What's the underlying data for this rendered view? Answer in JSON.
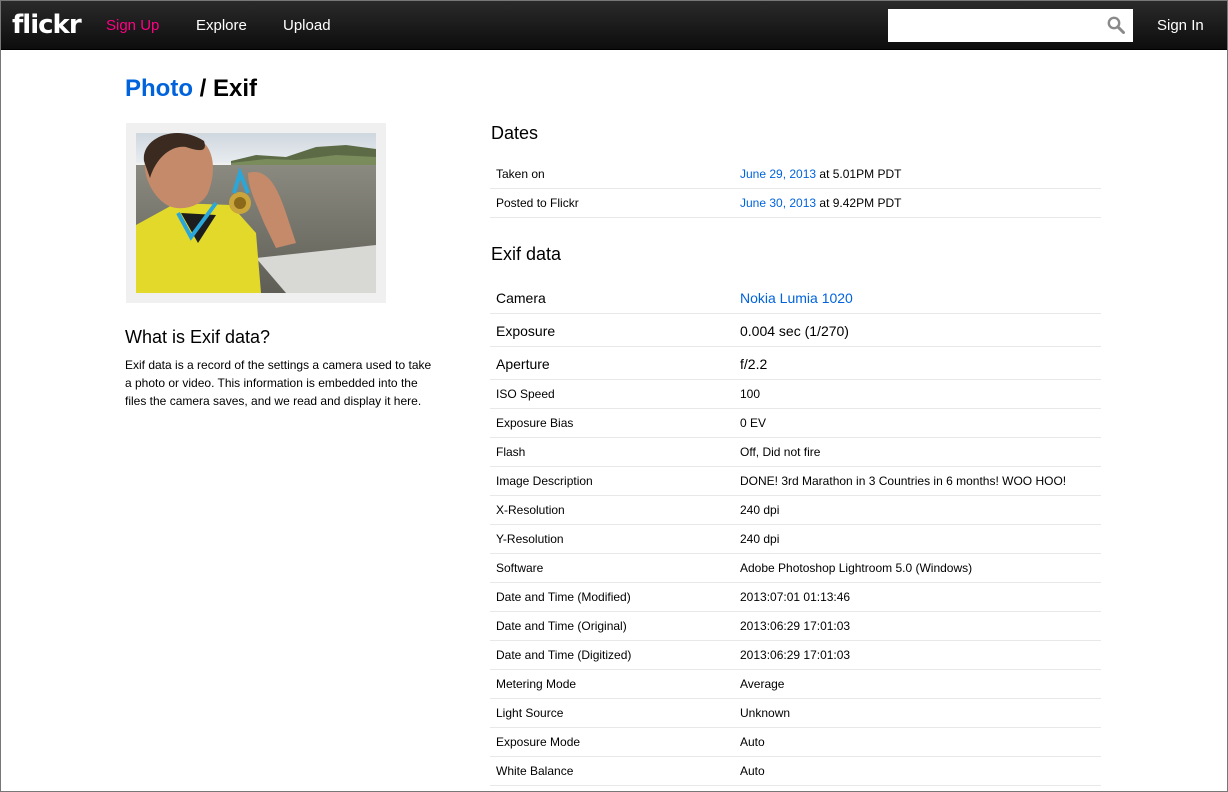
{
  "nav": {
    "logo": "flickr",
    "signup": "Sign Up",
    "explore": "Explore",
    "upload": "Upload",
    "search_placeholder": "",
    "signin": "Sign In",
    "colors": {
      "bar": "#111111",
      "signup": "#ff0084",
      "link": "#0063dc"
    }
  },
  "breadcrumb": {
    "photo": "Photo",
    "separator": " / ",
    "current": "Exif"
  },
  "sidebar": {
    "heading": "What is Exif data?",
    "text": "Exif data is a record of the settings a camera used to take a photo or video. This information is embedded into the files the camera saves, and we read and display it here."
  },
  "dates": {
    "heading": "Dates",
    "rows": [
      {
        "label": "Taken on",
        "date": "June 29, 2013",
        "time": " at 5.01PM PDT"
      },
      {
        "label": "Posted to Flickr",
        "date": "June 30, 2013",
        "time": " at 9.42PM PDT"
      }
    ]
  },
  "exif": {
    "heading": "Exif data",
    "camera": {
      "label": "Camera",
      "value": "Nokia Lumia 1020"
    },
    "exposure": {
      "label": "Exposure",
      "value": "0.004 sec (1/270)"
    },
    "aperture": {
      "label": "Aperture",
      "value": "f/2.2"
    },
    "rows": [
      {
        "label": "ISO Speed",
        "value": "100"
      },
      {
        "label": "Exposure Bias",
        "value": "0 EV"
      },
      {
        "label": "Flash",
        "value": "Off, Did not fire"
      },
      {
        "label": "Image Description",
        "value": "DONE! 3rd Marathon in 3 Countries in 6 months! WOO HOO!"
      },
      {
        "label": "X-Resolution",
        "value": "240 dpi"
      },
      {
        "label": "Y-Resolution",
        "value": "240 dpi"
      },
      {
        "label": "Software",
        "value": "Adobe Photoshop Lightroom 5.0 (Windows)"
      },
      {
        "label": "Date and Time (Modified)",
        "value": "2013:07:01 01:13:46"
      },
      {
        "label": "Date and Time (Original)",
        "value": "2013:06:29 17:01:03"
      },
      {
        "label": "Date and Time (Digitized)",
        "value": "2013:06:29 17:01:03"
      },
      {
        "label": "Metering Mode",
        "value": "Average"
      },
      {
        "label": "Light Source",
        "value": "Unknown"
      },
      {
        "label": "Exposure Mode",
        "value": "Auto"
      },
      {
        "label": "White Balance",
        "value": "Auto"
      }
    ]
  }
}
